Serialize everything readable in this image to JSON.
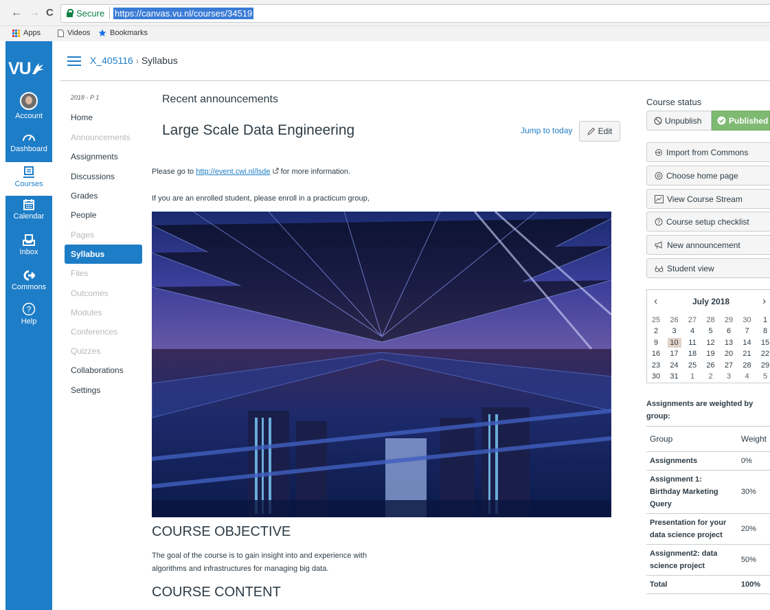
{
  "browser": {
    "back_icon": "←",
    "forward_icon": "→",
    "reload_icon": "C",
    "secure_label": "Secure",
    "url": "https://canvas.vu.nl/courses/34519",
    "bookmarks": [
      "Apps",
      "Videos",
      "Bookmarks"
    ]
  },
  "global_nav": {
    "logo": "VU",
    "items": [
      {
        "label": "Account",
        "icon": "avatar"
      },
      {
        "label": "Dashboard",
        "icon": "dashboard-icon"
      },
      {
        "label": "Courses",
        "icon": "courses-icon",
        "active": true
      },
      {
        "label": "Calendar",
        "icon": "calendar-icon"
      },
      {
        "label": "Inbox",
        "icon": "inbox-icon"
      },
      {
        "label": "Commons",
        "icon": "commons-icon"
      },
      {
        "label": "Help",
        "icon": "help-icon"
      }
    ]
  },
  "breadcrumb": {
    "course": "X_405116",
    "separator": "›",
    "page": "Syllabus"
  },
  "course_nav": {
    "term": "2018 - P 1",
    "items": [
      {
        "label": "Home",
        "disabled": false
      },
      {
        "label": "Announcements",
        "disabled": true
      },
      {
        "label": "Assignments",
        "disabled": false
      },
      {
        "label": "Discussions",
        "disabled": false
      },
      {
        "label": "Grades",
        "disabled": false
      },
      {
        "label": "People",
        "disabled": false
      },
      {
        "label": "Pages",
        "disabled": true
      },
      {
        "label": "Syllabus",
        "active": true
      },
      {
        "label": "Files",
        "disabled": true
      },
      {
        "label": "Outcomes",
        "disabled": true
      },
      {
        "label": "Modules",
        "disabled": true
      },
      {
        "label": "Conferences",
        "disabled": true
      },
      {
        "label": "Quizzes",
        "disabled": true
      },
      {
        "label": "Collaborations",
        "disabled": false
      },
      {
        "label": "Settings",
        "disabled": false
      }
    ]
  },
  "main": {
    "recent_title": "Recent announcements",
    "title": "Large Scale Data Engineering",
    "jump_today": "Jump to today",
    "edit_label": "Edit",
    "para1_before": "Please go to ",
    "para1_link": "http://event.cwi.nl/lsde",
    "para1_after": " for more information.",
    "para2": "If you are an enrolled student, please enroll in a practicum group,",
    "objective_heading": "COURSE OBJECTIVE",
    "objective_text_1": "The goal of the course is to gain insight into and experience with",
    "objective_text_2": "algorithms and infrastructures for managing big data.",
    "content_heading": "COURSE CONTENT"
  },
  "sidebar": {
    "course_status_title": "Course status",
    "unpublish_label": "Unpublish",
    "published_label": "Published",
    "buttons": [
      {
        "label": "Import from Commons",
        "icon": "import-icon"
      },
      {
        "label": "Choose home page",
        "icon": "home-page-icon"
      },
      {
        "label": "View Course Stream",
        "icon": "stream-icon"
      },
      {
        "label": "Course setup checklist",
        "icon": "checklist-icon"
      },
      {
        "label": "New announcement",
        "icon": "announcement-icon"
      },
      {
        "label": "Student view",
        "icon": "student-view-icon"
      }
    ],
    "calendar": {
      "month": "July 2018",
      "prev_icon": "‹",
      "next_icon": "›",
      "weeks": [
        [
          "25",
          "26",
          "27",
          "28",
          "29",
          "30",
          "1"
        ],
        [
          "2",
          "3",
          "4",
          "5",
          "6",
          "7",
          "8"
        ],
        [
          "9",
          "10",
          "11",
          "12",
          "13",
          "14",
          "15"
        ],
        [
          "16",
          "17",
          "18",
          "19",
          "20",
          "21",
          "22"
        ],
        [
          "23",
          "24",
          "25",
          "26",
          "27",
          "28",
          "29"
        ],
        [
          "30",
          "31",
          "1",
          "2",
          "3",
          "4",
          "5"
        ]
      ],
      "today": "10"
    },
    "weights_title": "Assignments are weighted by group:",
    "weights": {
      "header": {
        "group": "Group",
        "weight": "Weight"
      },
      "rows": [
        {
          "group": "Assignments",
          "weight": "0%"
        },
        {
          "group": "Assignment 1: Birthday Marketing Query",
          "weight": "30%"
        },
        {
          "group": "Presentation for your data science project",
          "weight": "20%"
        },
        {
          "group": "Assignment2: data science project",
          "weight": "50%"
        },
        {
          "group": "Total",
          "weight": "100%"
        }
      ]
    }
  }
}
